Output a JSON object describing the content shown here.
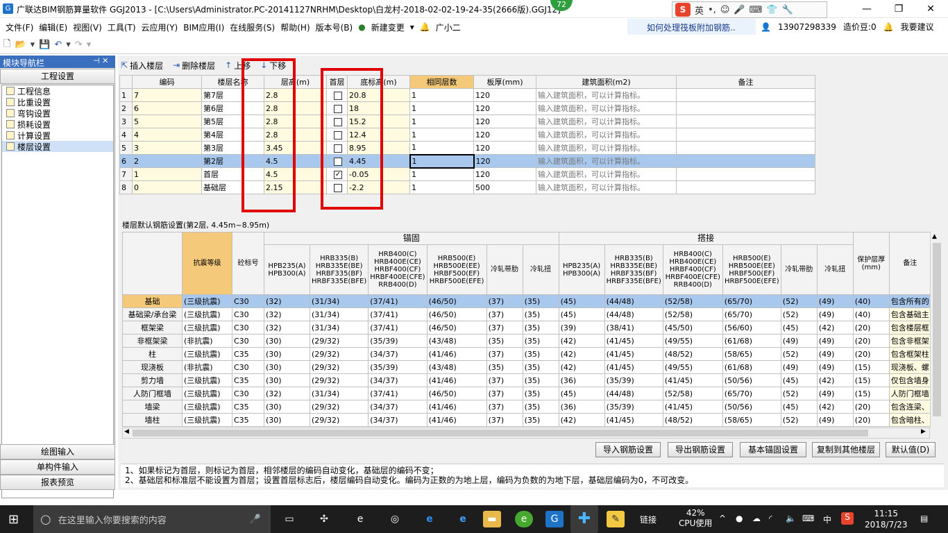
{
  "window": {
    "title": "广联达BIM钢筋算量软件 GGJ2013 - [C:\\Users\\Administrator.PC-20141127NRHM\\Desktop\\白龙村-2018-02-02-19-24-35(2666版).GGJ12]",
    "badge": "72",
    "ime_label": "英"
  },
  "menu": [
    "文件(F)",
    "编辑(E)",
    "视图(V)",
    "工具(T)",
    "云应用(Y)",
    "BIM应用(I)",
    "在线服务(S)",
    "帮助(H)",
    "版本号(B)",
    "新建变更",
    "广小二"
  ],
  "question": "如何处理筏板附加钢筋..",
  "account": {
    "phone": "13907298339",
    "coins": "造价豆:0",
    "suggest": "我要建议"
  },
  "nav": {
    "title": "模块导航栏",
    "section": "工程设置",
    "items": [
      "工程信息",
      "比重设置",
      "弯钩设置",
      "损耗设置",
      "计算设置",
      "楼层设置"
    ],
    "selected": "楼层设置",
    "bottom": [
      "绘图输入",
      "单构件输入",
      "报表预览"
    ]
  },
  "floor_toolbar": {
    "insert": "插入楼层",
    "delete": "删除楼层",
    "up": "上移",
    "down": "下移"
  },
  "floor_table": {
    "headers": [
      "",
      "编码",
      "楼层名称",
      "层高(m)",
      "首层",
      "底标高(m)",
      "相同层数",
      "板厚(mm)",
      "建筑面积(m2)",
      "备注"
    ],
    "rows": [
      {
        "n": "1",
        "code": "7",
        "name": "第7层",
        "height": "2.8",
        "first": false,
        "bottom": "20.8",
        "same": "1",
        "thick": "120",
        "area": "输入建筑面积，可以计算指标。"
      },
      {
        "n": "2",
        "code": "6",
        "name": "第6层",
        "height": "2.8",
        "first": false,
        "bottom": "18",
        "same": "1",
        "thick": "120",
        "area": "输入建筑面积，可以计算指标。"
      },
      {
        "n": "3",
        "code": "5",
        "name": "第5层",
        "height": "2.8",
        "first": false,
        "bottom": "15.2",
        "same": "1",
        "thick": "120",
        "area": "输入建筑面积，可以计算指标。"
      },
      {
        "n": "4",
        "code": "4",
        "name": "第4层",
        "height": "2.8",
        "first": false,
        "bottom": "12.4",
        "same": "1",
        "thick": "120",
        "area": "输入建筑面积，可以计算指标。"
      },
      {
        "n": "5",
        "code": "3",
        "name": "第3层",
        "height": "3.45",
        "first": false,
        "bottom": "8.95",
        "same": "1",
        "thick": "120",
        "area": "输入建筑面积，可以计算指标。"
      },
      {
        "n": "6",
        "code": "2",
        "name": "第2层",
        "height": "4.5",
        "first": false,
        "bottom": "4.45",
        "same": "1",
        "thick": "120",
        "area": "输入建筑面积，可以计算指标。"
      },
      {
        "n": "7",
        "code": "1",
        "name": "首层",
        "height": "4.5",
        "first": true,
        "bottom": "-0.05",
        "same": "1",
        "thick": "120",
        "area": "输入建筑面积，可以计算指标。"
      },
      {
        "n": "8",
        "code": "0",
        "name": "基础层",
        "height": "2.15",
        "first": false,
        "bottom": "-2.2",
        "same": "1",
        "thick": "500",
        "area": "输入建筑面积，可以计算指标。"
      }
    ]
  },
  "rebar_label": "楼层默认钢筋设置(第2层, 4.45m~8.95m)",
  "rebar_table": {
    "group_anchor": "锚固",
    "group_lap": "搭接",
    "h_seismic": "抗震等级",
    "h_concrete": "砼标号",
    "h_cover": "保护层厚(mm)",
    "h_notes": "备注",
    "steel_headers": [
      "HPB235(A)\nHPB300(A)",
      "HRB335(B)\nHRB335E(BE)\nHRBF335(BF)\nHRBF335E(BFE)",
      "HRB400(C)\nHRB400E(CE)\nHRBF400(CF)\nHRBF400E(CFE)\nRRB400(D)",
      "HRB500(E)\nHRB500E(EE)\nHRBF500(EF)\nHRBF500E(EFE)",
      "冷轧带肋",
      "冷轧扭"
    ],
    "rows": [
      {
        "label": "基础",
        "seismic": "(三级抗震)",
        "conc": "C30",
        "anchor": [
          "(32)",
          "(31/34)",
          "(37/41)",
          "(46/50)",
          "(37)",
          "(35)"
        ],
        "lap": [
          "(45)",
          "(44/48)",
          "(52/58)",
          "(65/70)",
          "(52)",
          "(49)"
        ],
        "cover": "(40)",
        "note": "包含所有的"
      },
      {
        "label": "基础梁/承台梁",
        "seismic": "(三级抗震)",
        "conc": "C30",
        "anchor": [
          "(32)",
          "(31/34)",
          "(37/41)",
          "(46/50)",
          "(37)",
          "(35)"
        ],
        "lap": [
          "(45)",
          "(44/48)",
          "(52/58)",
          "(65/70)",
          "(52)",
          "(49)"
        ],
        "cover": "(40)",
        "note": "包含基础主"
      },
      {
        "label": "框架梁",
        "seismic": "(三级抗震)",
        "conc": "C30",
        "anchor": [
          "(32)",
          "(31/34)",
          "(37/41)",
          "(46/50)",
          "(37)",
          "(35)"
        ],
        "lap": [
          "(39)",
          "(38/41)",
          "(45/50)",
          "(56/60)",
          "(45)",
          "(42)"
        ],
        "cover": "(20)",
        "note": "包含楼层框"
      },
      {
        "label": "非框架梁",
        "seismic": "(非抗震)",
        "conc": "C30",
        "anchor": [
          "(30)",
          "(29/32)",
          "(35/39)",
          "(43/48)",
          "(35)",
          "(35)"
        ],
        "lap": [
          "(42)",
          "(41/45)",
          "(49/55)",
          "(61/68)",
          "(49)",
          "(49)"
        ],
        "cover": "(20)",
        "note": "包含非框架"
      },
      {
        "label": "柱",
        "seismic": "(三级抗震)",
        "conc": "C35",
        "anchor": [
          "(30)",
          "(29/32)",
          "(34/37)",
          "(41/46)",
          "(37)",
          "(35)"
        ],
        "lap": [
          "(42)",
          "(41/45)",
          "(48/52)",
          "(58/65)",
          "(52)",
          "(49)"
        ],
        "cover": "(20)",
        "note": "包含框架柱"
      },
      {
        "label": "现浇板",
        "seismic": "(非抗震)",
        "conc": "C30",
        "anchor": [
          "(30)",
          "(29/32)",
          "(35/39)",
          "(43/48)",
          "(35)",
          "(35)"
        ],
        "lap": [
          "(42)",
          "(41/45)",
          "(49/55)",
          "(61/68)",
          "(49)",
          "(49)"
        ],
        "cover": "(15)",
        "note": "现浇板、螺"
      },
      {
        "label": "剪力墙",
        "seismic": "(三级抗震)",
        "conc": "C35",
        "anchor": [
          "(30)",
          "(29/32)",
          "(34/37)",
          "(41/46)",
          "(37)",
          "(35)"
        ],
        "lap": [
          "(36)",
          "(35/39)",
          "(41/45)",
          "(50/56)",
          "(45)",
          "(42)"
        ],
        "cover": "(15)",
        "note": "仅包含墙身"
      },
      {
        "label": "人防门框墙",
        "seismic": "(三级抗震)",
        "conc": "C30",
        "anchor": [
          "(32)",
          "(31/34)",
          "(37/41)",
          "(46/50)",
          "(37)",
          "(35)"
        ],
        "lap": [
          "(45)",
          "(44/48)",
          "(52/58)",
          "(65/70)",
          "(52)",
          "(49)"
        ],
        "cover": "(15)",
        "note": "人防门框墙"
      },
      {
        "label": "墙梁",
        "seismic": "(三级抗震)",
        "conc": "C35",
        "anchor": [
          "(30)",
          "(29/32)",
          "(34/37)",
          "(41/46)",
          "(37)",
          "(35)"
        ],
        "lap": [
          "(36)",
          "(35/39)",
          "(41/45)",
          "(50/56)",
          "(45)",
          "(42)"
        ],
        "cover": "(20)",
        "note": "包含连梁、"
      },
      {
        "label": "墙柱",
        "seismic": "(三级抗震)",
        "conc": "C35",
        "anchor": [
          "(30)",
          "(29/32)",
          "(34/37)",
          "(41/46)",
          "(37)",
          "(35)"
        ],
        "lap": [
          "(42)",
          "(41/45)",
          "(48/52)",
          "(58/65)",
          "(52)",
          "(49)"
        ],
        "cover": "(20)",
        "note": "包含暗柱、"
      }
    ]
  },
  "buttons": [
    "导入钢筋设置",
    "导出钢筋设置",
    "基本锚固设置",
    "复制到其他楼层",
    "默认值(D)"
  ],
  "notes": [
    "1、如果标记为首层，则标记为首层，相邻楼层的编码自动变化，基础层的编码不变；",
    "2、基础层和标准层不能设置为首层；设置首层标志后，楼层编码自动变化。编码为正数的为地上层，编码为负数的为地下层，基础层编码为0，不可改变。"
  ],
  "taskbar": {
    "search_placeholder": "在这里输入你要搜索的内容",
    "link": "链接",
    "cpu_percent": "42%",
    "cpu_label": "CPU使用",
    "lang": "中",
    "time": "11:15",
    "date": "2018/7/23"
  }
}
